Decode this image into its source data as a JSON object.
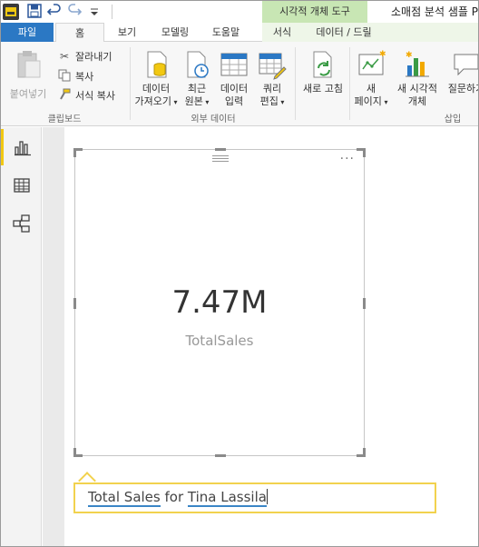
{
  "title_bar": {
    "context_group": "시각적 개체 도구",
    "window_title": "소매점 분석 샘플 P"
  },
  "tabs": {
    "file": "파일",
    "home": "홈",
    "view": "보기",
    "modeling": "모델링",
    "help": "도움말",
    "format": "서식",
    "data_drill": "데이터 / 드릴"
  },
  "ribbon": {
    "clipboard": {
      "paste": "붙여넣기",
      "cut": "잘라내기",
      "copy": "복사",
      "format_painter": "서식 복사",
      "group_label": "클립보드"
    },
    "external_data": {
      "get_data_1": "데이터",
      "get_data_2": "가져오기",
      "recent_1": "최근",
      "recent_2": "원본",
      "enter_data_1": "데이터",
      "enter_data_2": "입력",
      "edit_queries_1": "쿼리",
      "edit_queries_2": "편집",
      "group_label": "외부 데이터"
    },
    "refresh": "새로 고침",
    "insert": {
      "new_page_1": "새",
      "new_page_2": "페이지",
      "new_visual_1": "새 시각적",
      "new_visual_2": "개체",
      "ask_question": "질문하기",
      "group_label": "삽입"
    }
  },
  "visual": {
    "value": "7.47M",
    "label": "TotalSales",
    "more_glyph": "···"
  },
  "qa": {
    "part1": "Total Sales",
    "part2": " for ",
    "part3": "Tina Lassila"
  },
  "colors": {
    "accent_file_tab": "#2b78c4",
    "context_green": "#c8e6b4",
    "powerbi_yellow": "#f2c811",
    "qa_border": "#f2d24e",
    "underline_blue": "#3b86c6"
  }
}
